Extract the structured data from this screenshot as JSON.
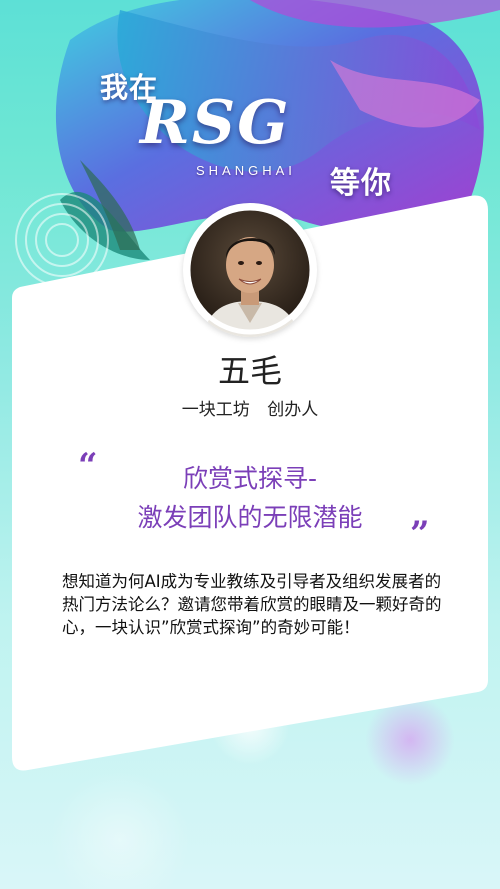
{
  "hero": {
    "line1": "我在",
    "logo": "RSG",
    "sub": "SHANGHAI",
    "line2": "等你"
  },
  "speaker": {
    "name": "五毛",
    "company": "一块工坊",
    "title": "创办人"
  },
  "talk": {
    "open_quote": "“",
    "close_quote": "”",
    "title_line1": "欣赏式探寻-",
    "title_line2": "激发团队的无限潜能",
    "description": "想知道为何AI成为专业教练及引导者及组织发展者的热门方法论么？邀请您带着欣赏的眼睛及一颗好奇的心，一块认识”欣赏式探询”的奇妙可能！"
  },
  "colors": {
    "accent": "#7b3fb8",
    "background_top": "#5de0d6",
    "background_bottom": "#d9f6f8",
    "card": "#ffffff"
  },
  "icons": [
    "avatar-photo"
  ]
}
